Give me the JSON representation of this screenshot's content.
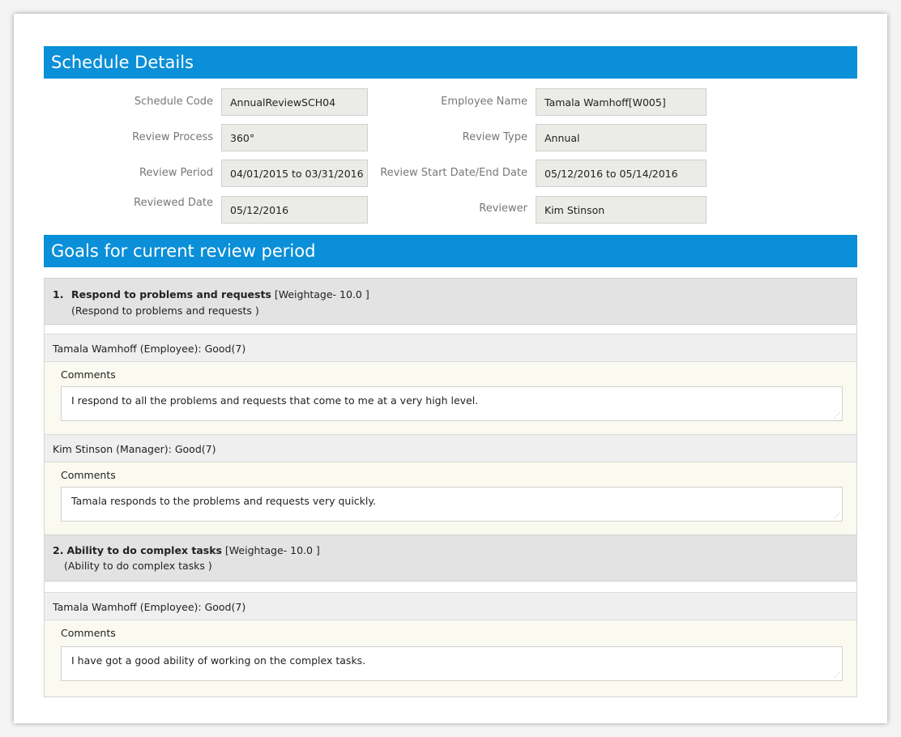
{
  "schedule": {
    "header": "Schedule Details",
    "fields": {
      "schedule_code": {
        "label": "Schedule Code",
        "value": "AnnualReviewSCH04"
      },
      "employee_name": {
        "label": "Employee Name",
        "value": "Tamala Wamhoff[W005]"
      },
      "review_process": {
        "label": "Review Process",
        "value": "360°"
      },
      "review_type": {
        "label": "Review Type",
        "value": "Annual"
      },
      "review_period": {
        "label": "Review Period",
        "value": "04/01/2015 to 03/31/2016"
      },
      "review_start_end": {
        "label": "Review Start Date/End Date",
        "value": "05/12/2016 to 05/14/2016"
      },
      "reviewed_date": {
        "label": "Reviewed Date",
        "value": "05/12/2016"
      },
      "reviewer": {
        "label": "Reviewer",
        "value": "Kim Stinson"
      }
    }
  },
  "goals": {
    "header": "Goals for current review period",
    "items": [
      {
        "number": "1.",
        "title": "Respond to problems and requests",
        "weightage": " [Weightage- 10.0 ]",
        "description": "(Respond to problems and requests )",
        "ratings": [
          {
            "rater": "Tamala Wamhoff (Employee): Good(7)",
            "comments_label": "Comments",
            "comment": "I respond to all the problems and requests that come to me at a very high level."
          },
          {
            "rater": "Kim Stinson (Manager): Good(7)",
            "comments_label": "Comments",
            "comment": "Tamala responds to the problems and requests very quickly."
          }
        ]
      },
      {
        "number": "2.",
        "title": "Ability to do complex tasks",
        "weightage": " [Weightage- 10.0 ]",
        "description": "(Ability to do complex tasks )",
        "ratings": [
          {
            "rater": "Tamala Wamhoff (Employee): Good(7)",
            "comments_label": "Comments",
            "comment": "I have got a good ability of working on the complex tasks."
          }
        ]
      }
    ]
  },
  "icons": {
    "resize_grip": "resize-grip-icon",
    "grip_glyph": "⋰"
  },
  "colors": {
    "header_blue": "#0a8fd8",
    "goal_head_bg": "#e3e3e3",
    "comments_bg": "#fafaf0"
  }
}
